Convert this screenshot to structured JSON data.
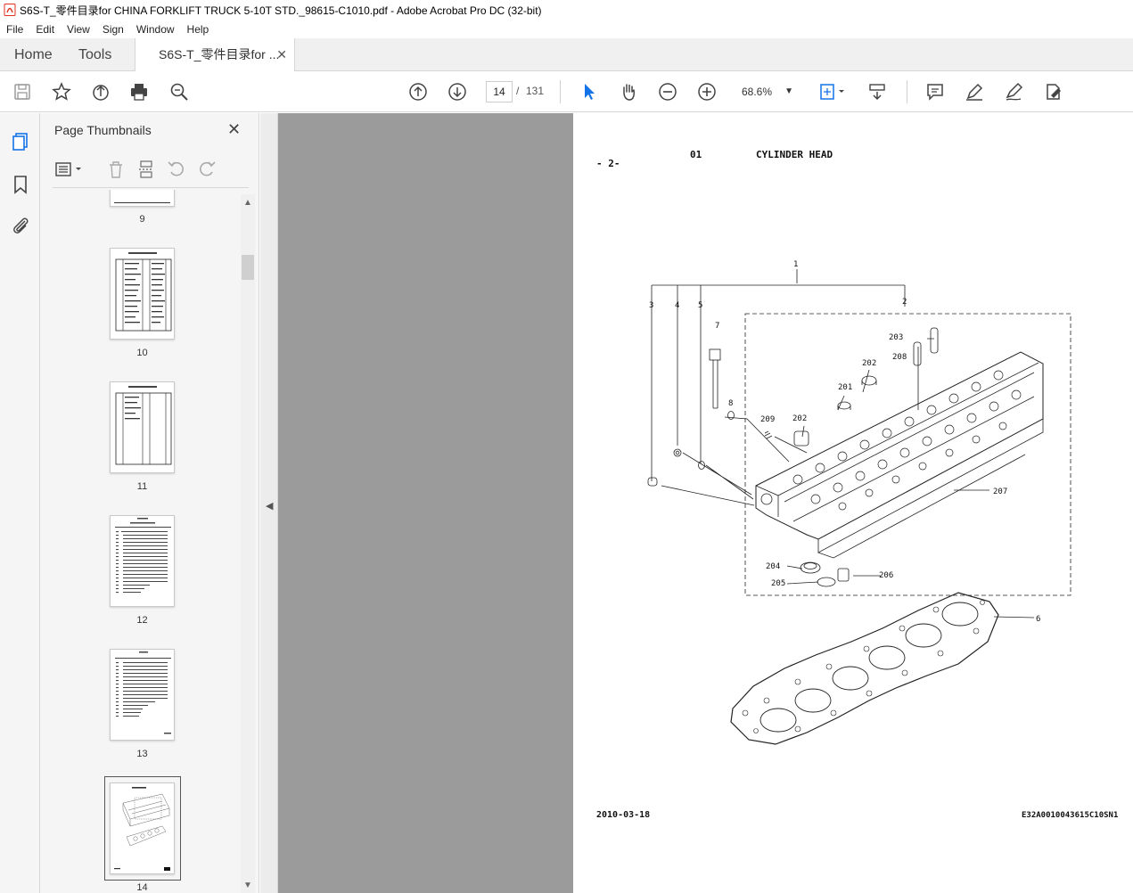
{
  "window": {
    "title": "S6S-T_零件目录for CHINA FORKLIFT TRUCK 5-10T STD._98615-C1010.pdf - Adobe Acrobat Pro DC (32-bit)"
  },
  "menu": [
    "File",
    "Edit",
    "View",
    "Sign",
    "Window",
    "Help"
  ],
  "tabs": {
    "home": "Home",
    "tools": "Tools",
    "document": "S6S-T_零件目录for ..."
  },
  "toolbar": {
    "current_page": "14",
    "separator": "/",
    "total_pages": "131",
    "zoom": "68.6%"
  },
  "panel": {
    "title": "Page Thumbnails",
    "thumbnails": [
      {
        "label": "9"
      },
      {
        "label": "10"
      },
      {
        "label": "11"
      },
      {
        "label": "12"
      },
      {
        "label": "13"
      },
      {
        "label": "14",
        "selected": true
      }
    ]
  },
  "page": {
    "header_page": "- 2-",
    "section_code": "01",
    "section_title": "CYLINDER HEAD",
    "date": "2010-03-18",
    "doc_code": "E32A0010043615C10SN1",
    "callouts": [
      "1",
      "2",
      "3",
      "4",
      "5",
      "6",
      "7",
      "8",
      "201",
      "202",
      "202",
      "203",
      "204",
      "205",
      "206",
      "207",
      "208",
      "209"
    ]
  },
  "colors": {
    "accent": "#1473e6",
    "panel_bg": "#f5f5f5",
    "doc_gray": "#9b9b9b",
    "pdf_icon": "#e0301e"
  }
}
